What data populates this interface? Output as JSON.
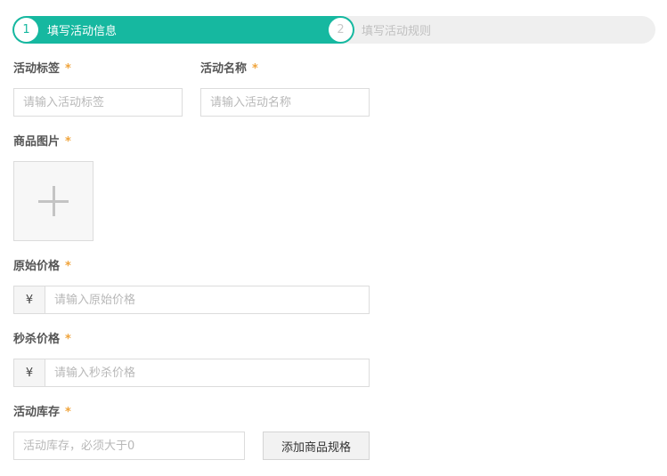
{
  "stepper": {
    "steps": [
      {
        "number": "1",
        "label": "填写活动信息"
      },
      {
        "number": "2",
        "label": "填写活动规则"
      }
    ]
  },
  "form": {
    "required_mark": "*",
    "activity_tag": {
      "label": "活动标签",
      "placeholder": "请输入活动标签",
      "value": ""
    },
    "activity_name": {
      "label": "活动名称",
      "placeholder": "请输入活动名称",
      "value": ""
    },
    "product_image": {
      "label": "商品图片"
    },
    "original_price": {
      "label": "原始价格",
      "currency": "¥",
      "placeholder": "请输入原始价格",
      "value": ""
    },
    "flash_price": {
      "label": "秒杀价格",
      "currency": "¥",
      "placeholder": "请输入秒杀价格",
      "value": ""
    },
    "activity_stock": {
      "label": "活动库存",
      "placeholder": "活动库存，必须大于0",
      "value": ""
    },
    "add_spec_button": "添加商品规格"
  },
  "colors": {
    "accent": "#16b8a0",
    "required": "#f0a43c"
  }
}
